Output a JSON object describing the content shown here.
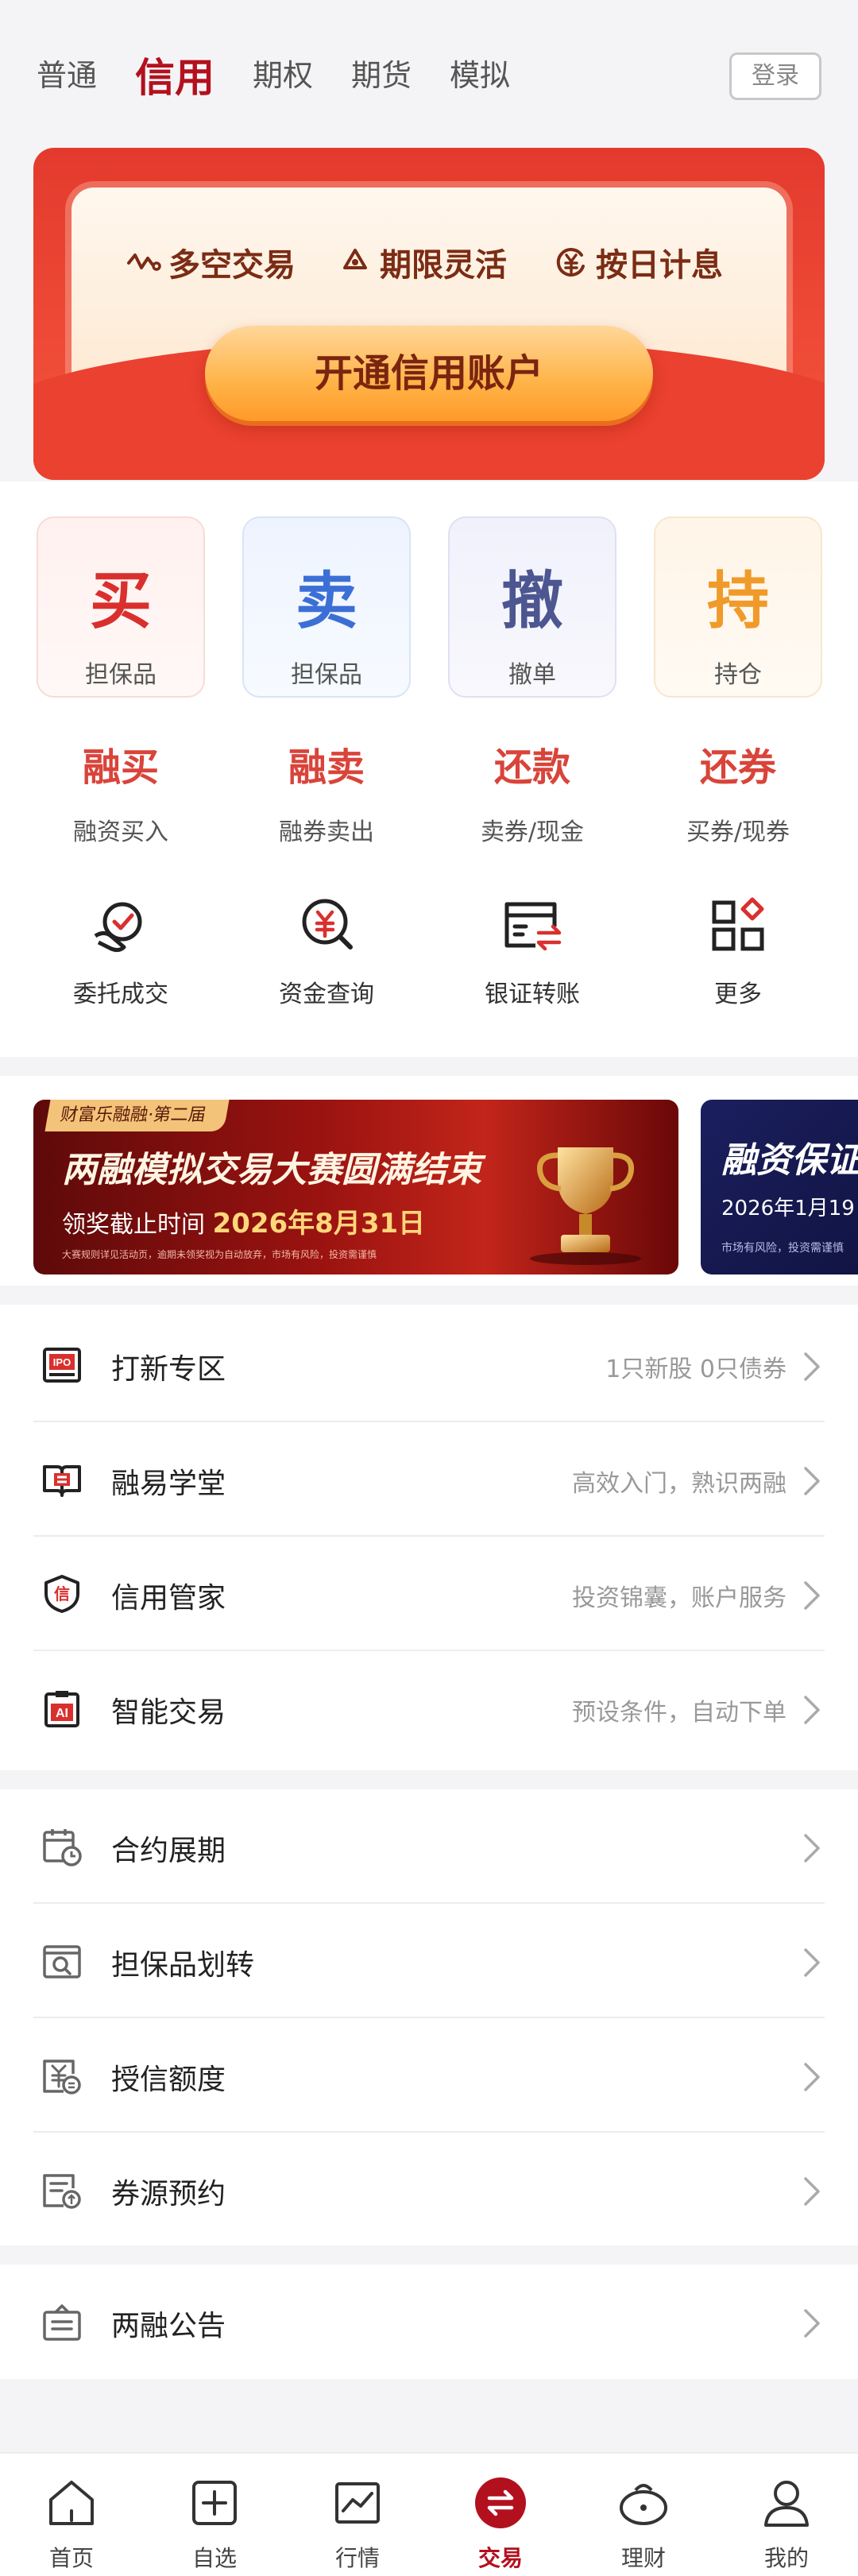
{
  "top_tabs": {
    "normal": "普通",
    "credit": "信用",
    "options": "期权",
    "futures": "期货",
    "simulate": "模拟",
    "login": "登录"
  },
  "banner": {
    "features": [
      "多空交易",
      "期限灵活",
      "按日计息"
    ],
    "open_button": "开通信用账户"
  },
  "quick_trade": [
    {
      "char": "买",
      "label": "担保品",
      "color": "#d9302e"
    },
    {
      "char": "卖",
      "label": "担保品",
      "color": "#3c6fd6"
    },
    {
      "char": "撤",
      "label": "撤单",
      "color": "#4c5690"
    },
    {
      "char": "持",
      "label": "持仓",
      "color": "#f09a2a"
    }
  ],
  "margin_ops": [
    {
      "title": "融买",
      "sub": "融资买入"
    },
    {
      "title": "融卖",
      "sub": "融券卖出"
    },
    {
      "title": "还款",
      "sub": "卖券/现金"
    },
    {
      "title": "还券",
      "sub": "买券/现券"
    }
  ],
  "tools": [
    {
      "label": "委托成交",
      "icon": "order-fill-icon"
    },
    {
      "label": "资金查询",
      "icon": "fund-search-icon"
    },
    {
      "label": "银证转账",
      "icon": "bank-transfer-icon"
    },
    {
      "label": "更多",
      "icon": "more-grid-icon"
    }
  ],
  "promo1": {
    "tag": "财富乐融融·第二届",
    "title": "两融模拟交易大赛圆满结束",
    "deadline_label": "领奖截止时间",
    "deadline_date": "2026年8月31日",
    "fine": "大赛规则详见活动页，逾期未领奖视为自动放弃，市场有风险，投资需谨慎"
  },
  "promo2": {
    "title": "融资保证",
    "date": "2026年1月19",
    "fine": "市场有风险，投资需谨慎"
  },
  "list1": [
    {
      "label": "打新专区",
      "desc": "1只新股 0只债券",
      "icon": "ipo-icon"
    },
    {
      "label": "融易学堂",
      "desc": "高效入门，熟识两融",
      "icon": "book-icon"
    },
    {
      "label": "信用管家",
      "desc": "投资锦囊，账户服务",
      "icon": "shield-credit-icon"
    },
    {
      "label": "智能交易",
      "desc": "预设条件，自动下单",
      "icon": "ai-clipboard-icon"
    }
  ],
  "list2": [
    {
      "label": "合约展期",
      "icon": "calendar-clock-icon"
    },
    {
      "label": "担保品划转",
      "icon": "collateral-transfer-icon"
    },
    {
      "label": "授信额度",
      "icon": "credit-limit-icon"
    },
    {
      "label": "券源预约",
      "icon": "securities-reserve-icon"
    }
  ],
  "list3": [
    {
      "label": "两融公告",
      "icon": "announcement-icon"
    }
  ],
  "bottom_nav": [
    {
      "label": "首页",
      "icon": "home-icon"
    },
    {
      "label": "自选",
      "icon": "add-square-icon"
    },
    {
      "label": "行情",
      "icon": "chart-icon"
    },
    {
      "label": "交易",
      "icon": "trade-icon"
    },
    {
      "label": "理财",
      "icon": "wallet-icon"
    },
    {
      "label": "我的",
      "icon": "user-icon"
    }
  ],
  "colors": {
    "brand": "#b3101e",
    "accent_red": "#d9443a",
    "banner_red": "#e33a2d"
  }
}
